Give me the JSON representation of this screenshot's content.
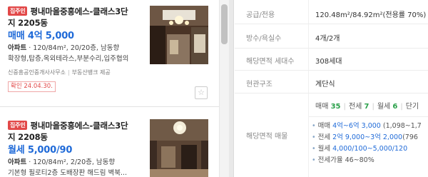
{
  "listings": [
    {
      "badge": "집주인",
      "title_line1": "평내마을중흥에스-클래스3단",
      "title_line2": "지 2205동",
      "price": "매매 4억 5,000",
      "detail_type": "아파트",
      "detail_spec": " · 120/84m², 20/20층, 남동향",
      "detail_features": "확장형,탑층,옥외테라스,부분수리,입주협의",
      "agent": "신중흥공인중개사사무소",
      "agent_provider": "부동산뱅크 제공",
      "confirm_date": "확인 24.04.30."
    },
    {
      "badge": "집주인",
      "title_line1": "평내마을중흥에스-클래스3단",
      "title_line2": "지 2208동",
      "price": "월세 5,000/90",
      "detail_type": "아파트",
      "detail_spec": " · 120/84m², 2/20층, 남동향",
      "detail_features": "기본형 필로티2층 도배장판 해드림 벽북..."
    }
  ],
  "details": {
    "supply_area_label": "공급/전용",
    "supply_area_value": "120.48m²/84.92m²(전용률 70%)",
    "rooms_label": "방수/욕실수",
    "rooms_value": "4개/2개",
    "households_label": "해당면적 세대수",
    "households_value": "308세대",
    "entrance_label": "현관구조",
    "entrance_value": "계단식",
    "listings_label": "해당면적 매물",
    "sale_label": "매매",
    "sale_count": "35",
    "jeonse_label": "전세",
    "jeonse_count": "7",
    "monthly_label": "월세",
    "monthly_count": "6",
    "short_label": "단기",
    "range_sale_prefix": "매매 ",
    "range_sale_value": "4억~6억 3,000",
    "range_sale_suffix": " (1,098~1,7",
    "range_jeonse_prefix": "전세 ",
    "range_jeonse_value": "2억 9,000~3억 2,000",
    "range_jeonse_suffix": "(796",
    "range_monthly_prefix": "월세 ",
    "range_monthly_value": "4,000/100~5,000/120",
    "jeonse_ratio": "전세가율 46~80%"
  },
  "colors": {
    "price_blue": "#1f6ad8",
    "badge_red": "#e24848",
    "count_green": "#2aa04a"
  }
}
